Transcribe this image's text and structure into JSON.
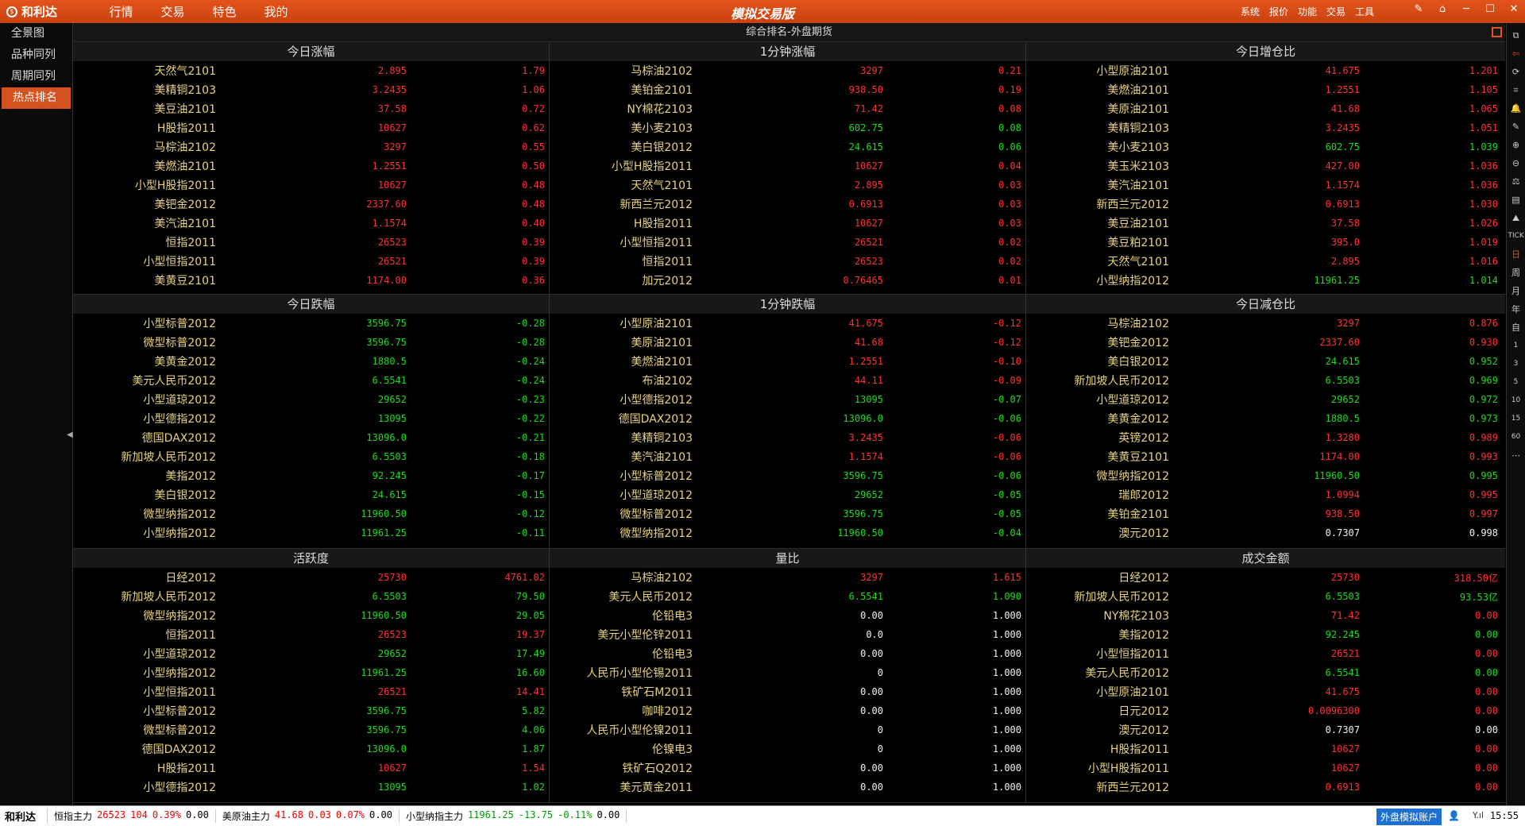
{
  "app": {
    "logo_text": "和利达",
    "logo_icon": "logo-icon",
    "title": "模拟交易版",
    "menu": [
      "行情",
      "交易",
      "特色",
      "我的"
    ],
    "right_menu": [
      "系统",
      "报价",
      "功能",
      "交易",
      "工具"
    ],
    "window_controls": [
      "✎",
      "⌂",
      "─",
      "☐",
      "✕"
    ]
  },
  "leftnav": {
    "items": [
      "全景图",
      "品种同列",
      "周期同列",
      "热点排名"
    ],
    "active_index": 3
  },
  "main": {
    "title": "综合排名-外盘期货"
  },
  "colors": {
    "up": "#ff3232",
    "down": "#1edc1e",
    "flat": "#f0f0f0",
    "name": "#e8d27a",
    "accent": "#e4541c"
  },
  "panels": [
    {
      "title": "今日涨幅",
      "rows": [
        [
          "天然气2101",
          "2.895",
          "r",
          "1.79",
          "r"
        ],
        [
          "美精铜2103",
          "3.2435",
          "r",
          "1.06",
          "r"
        ],
        [
          "美豆油2101",
          "37.58",
          "r",
          "0.72",
          "r"
        ],
        [
          "H股指2011",
          "10627",
          "r",
          "0.62",
          "r"
        ],
        [
          "马棕油2102",
          "3297",
          "r",
          "0.55",
          "r"
        ],
        [
          "美燃油2101",
          "1.2551",
          "r",
          "0.50",
          "r"
        ],
        [
          "小型H股指2011",
          "10627",
          "r",
          "0.48",
          "r"
        ],
        [
          "美钯金2012",
          "2337.60",
          "r",
          "0.48",
          "r"
        ],
        [
          "美汽油2101",
          "1.1574",
          "r",
          "0.40",
          "r"
        ],
        [
          "恒指2011",
          "26523",
          "r",
          "0.39",
          "r"
        ],
        [
          "小型恒指2011",
          "26521",
          "r",
          "0.39",
          "r"
        ],
        [
          "美黄豆2101",
          "1174.00",
          "r",
          "0.36",
          "r"
        ]
      ]
    },
    {
      "title": "1分钟涨幅",
      "rows": [
        [
          "马棕油2102",
          "3297",
          "r",
          "0.21",
          "r"
        ],
        [
          "美铂金2101",
          "938.50",
          "r",
          "0.19",
          "r"
        ],
        [
          "NY棉花2103",
          "71.42",
          "r",
          "0.08",
          "r"
        ],
        [
          "美小麦2103",
          "602.75",
          "g",
          "0.08",
          "g"
        ],
        [
          "美白银2012",
          "24.615",
          "g",
          "0.06",
          "g"
        ],
        [
          "小型H股指2011",
          "10627",
          "r",
          "0.04",
          "r"
        ],
        [
          "天然气2101",
          "2.895",
          "r",
          "0.03",
          "r"
        ],
        [
          "新西兰元2012",
          "0.6913",
          "r",
          "0.03",
          "r"
        ],
        [
          "H股指2011",
          "10627",
          "r",
          "0.03",
          "r"
        ],
        [
          "小型恒指2011",
          "26521",
          "r",
          "0.02",
          "r"
        ],
        [
          "恒指2011",
          "26523",
          "r",
          "0.02",
          "r"
        ],
        [
          "加元2012",
          "0.76465",
          "r",
          "0.01",
          "r"
        ]
      ]
    },
    {
      "title": "今日增仓比",
      "rows": [
        [
          "小型原油2101",
          "41.675",
          "r",
          "1.201",
          "r"
        ],
        [
          "美燃油2101",
          "1.2551",
          "r",
          "1.105",
          "r"
        ],
        [
          "美原油2101",
          "41.68",
          "r",
          "1.065",
          "r"
        ],
        [
          "美精铜2103",
          "3.2435",
          "r",
          "1.051",
          "r"
        ],
        [
          "美小麦2103",
          "602.75",
          "g",
          "1.039",
          "g"
        ],
        [
          "美玉米2103",
          "427.00",
          "r",
          "1.036",
          "r"
        ],
        [
          "美汽油2101",
          "1.1574",
          "r",
          "1.036",
          "r"
        ],
        [
          "新西兰元2012",
          "0.6913",
          "r",
          "1.030",
          "r"
        ],
        [
          "美豆油2101",
          "37.58",
          "r",
          "1.026",
          "r"
        ],
        [
          "美豆粕2101",
          "395.0",
          "r",
          "1.019",
          "r"
        ],
        [
          "天然气2101",
          "2.895",
          "r",
          "1.016",
          "r"
        ],
        [
          "小型纳指2012",
          "11961.25",
          "g",
          "1.014",
          "g"
        ]
      ]
    },
    {
      "title": "今日跌幅",
      "rows": [
        [
          "小型标普2012",
          "3596.75",
          "g",
          "-0.28",
          "g"
        ],
        [
          "微型标普2012",
          "3596.75",
          "g",
          "-0.28",
          "g"
        ],
        [
          "美黄金2012",
          "1880.5",
          "g",
          "-0.24",
          "g"
        ],
        [
          "美元人民币2012",
          "6.5541",
          "g",
          "-0.24",
          "g"
        ],
        [
          "小型道琼2012",
          "29652",
          "g",
          "-0.23",
          "g"
        ],
        [
          "小型德指2012",
          "13095",
          "g",
          "-0.22",
          "g"
        ],
        [
          "德国DAX2012",
          "13096.0",
          "g",
          "-0.21",
          "g"
        ],
        [
          "新加坡人民币2012",
          "6.5503",
          "g",
          "-0.18",
          "g"
        ],
        [
          "美指2012",
          "92.245",
          "g",
          "-0.17",
          "g"
        ],
        [
          "美白银2012",
          "24.615",
          "g",
          "-0.15",
          "g"
        ],
        [
          "微型纳指2012",
          "11960.50",
          "g",
          "-0.12",
          "g"
        ],
        [
          "小型纳指2012",
          "11961.25",
          "g",
          "-0.11",
          "g"
        ]
      ]
    },
    {
      "title": "1分钟跌幅",
      "rows": [
        [
          "小型原油2101",
          "41.675",
          "r",
          "-0.12",
          "r"
        ],
        [
          "美原油2101",
          "41.68",
          "r",
          "-0.12",
          "r"
        ],
        [
          "美燃油2101",
          "1.2551",
          "r",
          "-0.10",
          "r"
        ],
        [
          "布油2102",
          "44.11",
          "r",
          "-0.09",
          "r"
        ],
        [
          "小型德指2012",
          "13095",
          "g",
          "-0.07",
          "g"
        ],
        [
          "德国DAX2012",
          "13096.0",
          "g",
          "-0.06",
          "g"
        ],
        [
          "美精铜2103",
          "3.2435",
          "r",
          "-0.06",
          "r"
        ],
        [
          "美汽油2101",
          "1.1574",
          "r",
          "-0.06",
          "r"
        ],
        [
          "小型标普2012",
          "3596.75",
          "g",
          "-0.06",
          "g"
        ],
        [
          "小型道琼2012",
          "29652",
          "g",
          "-0.05",
          "g"
        ],
        [
          "微型标普2012",
          "3596.75",
          "g",
          "-0.05",
          "g"
        ],
        [
          "微型纳指2012",
          "11960.50",
          "g",
          "-0.04",
          "g"
        ]
      ]
    },
    {
      "title": "今日减仓比",
      "rows": [
        [
          "马棕油2102",
          "3297",
          "r",
          "0.876",
          "r"
        ],
        [
          "美钯金2012",
          "2337.60",
          "r",
          "0.930",
          "r"
        ],
        [
          "美白银2012",
          "24.615",
          "g",
          "0.952",
          "g"
        ],
        [
          "新加坡人民币2012",
          "6.5503",
          "g",
          "0.969",
          "g"
        ],
        [
          "小型道琼2012",
          "29652",
          "g",
          "0.972",
          "g"
        ],
        [
          "美黄金2012",
          "1880.5",
          "g",
          "0.973",
          "g"
        ],
        [
          "英镑2012",
          "1.3280",
          "r",
          "0.989",
          "r"
        ],
        [
          "美黄豆2101",
          "1174.00",
          "r",
          "0.993",
          "r"
        ],
        [
          "微型纳指2012",
          "11960.50",
          "g",
          "0.995",
          "g"
        ],
        [
          "瑞郎2012",
          "1.0994",
          "r",
          "0.995",
          "r"
        ],
        [
          "美铂金2101",
          "938.50",
          "r",
          "0.997",
          "r"
        ],
        [
          "澳元2012",
          "0.7307",
          "w",
          "0.998",
          "w"
        ]
      ]
    },
    {
      "title": "活跃度",
      "rows": [
        [
          "日经2012",
          "25730",
          "r",
          "4761.02",
          "r"
        ],
        [
          "新加坡人民币2012",
          "6.5503",
          "g",
          "79.50",
          "g"
        ],
        [
          "微型纳指2012",
          "11960.50",
          "g",
          "29.05",
          "g"
        ],
        [
          "恒指2011",
          "26523",
          "r",
          "19.37",
          "r"
        ],
        [
          "小型道琼2012",
          "29652",
          "g",
          "17.49",
          "g"
        ],
        [
          "小型纳指2012",
          "11961.25",
          "g",
          "16.60",
          "g"
        ],
        [
          "小型恒指2011",
          "26521",
          "r",
          "14.41",
          "r"
        ],
        [
          "小型标普2012",
          "3596.75",
          "g",
          "5.82",
          "g"
        ],
        [
          "微型标普2012",
          "3596.75",
          "g",
          "4.06",
          "g"
        ],
        [
          "德国DAX2012",
          "13096.0",
          "g",
          "1.87",
          "g"
        ],
        [
          "H股指2011",
          "10627",
          "r",
          "1.54",
          "r"
        ],
        [
          "小型德指2012",
          "13095",
          "g",
          "1.02",
          "g"
        ]
      ]
    },
    {
      "title": "量比",
      "rows": [
        [
          "马棕油2102",
          "3297",
          "r",
          "1.615",
          "r"
        ],
        [
          "美元人民币2012",
          "6.5541",
          "g",
          "1.090",
          "g"
        ],
        [
          "伦铅电3",
          "0.00",
          "w",
          "1.000",
          "w"
        ],
        [
          "美元小型伦锌2011",
          "0.0",
          "w",
          "1.000",
          "w"
        ],
        [
          "伦铅电3",
          "0.00",
          "w",
          "1.000",
          "w"
        ],
        [
          "人民币小型伦锡2011",
          "0",
          "w",
          "1.000",
          "w"
        ],
        [
          "铁矿石M2011",
          "0.00",
          "w",
          "1.000",
          "w"
        ],
        [
          "咖啡2012",
          "0.00",
          "w",
          "1.000",
          "w"
        ],
        [
          "人民币小型伦镍2011",
          "0",
          "w",
          "1.000",
          "w"
        ],
        [
          "伦镍电3",
          "0",
          "w",
          "1.000",
          "w"
        ],
        [
          "铁矿石Q2012",
          "0.00",
          "w",
          "1.000",
          "w"
        ],
        [
          "美元黄金2011",
          "0.00",
          "w",
          "1.000",
          "w"
        ]
      ]
    },
    {
      "title": "成交金额",
      "rows": [
        [
          "日经2012",
          "25730",
          "r",
          "318.50亿",
          "r"
        ],
        [
          "新加坡人民币2012",
          "6.5503",
          "g",
          "93.53亿",
          "g"
        ],
        [
          "NY棉花2103",
          "71.42",
          "r",
          "0.00",
          "r"
        ],
        [
          "美指2012",
          "92.245",
          "g",
          "0.00",
          "g"
        ],
        [
          "小型恒指2011",
          "26521",
          "r",
          "0.00",
          "r"
        ],
        [
          "美元人民币2012",
          "6.5541",
          "g",
          "0.00",
          "g"
        ],
        [
          "小型原油2101",
          "41.675",
          "r",
          "0.00",
          "r"
        ],
        [
          "日元2012",
          "0.0096300",
          "r",
          "0.00",
          "r"
        ],
        [
          "澳元2012",
          "0.7307",
          "w",
          "0.00",
          "w"
        ],
        [
          "H股指2011",
          "10627",
          "r",
          "0.00",
          "r"
        ],
        [
          "小型H股指2011",
          "10627",
          "r",
          "0.00",
          "r"
        ],
        [
          "新西兰元2012",
          "0.6913",
          "r",
          "0.00",
          "r"
        ]
      ]
    }
  ],
  "righttools": [
    {
      "glyph": "⧉",
      "icon": "window-icon",
      "hl": false
    },
    {
      "glyph": "⇦",
      "icon": "back-icon",
      "hl": true
    },
    {
      "glyph": "⟳",
      "icon": "refresh-icon",
      "hl": false
    },
    {
      "glyph": "⌗",
      "icon": "crop-icon",
      "hl": false
    },
    {
      "glyph": "🔔",
      "icon": "bell-icon",
      "hl": false
    },
    {
      "glyph": "✎",
      "icon": "pen-icon",
      "hl": false
    },
    {
      "glyph": "⊕",
      "icon": "zoom-in-icon",
      "hl": false
    },
    {
      "glyph": "⊖",
      "icon": "zoom-out-icon",
      "hl": false
    },
    {
      "glyph": "⚖",
      "icon": "balance-icon",
      "hl": false
    },
    {
      "glyph": "▤",
      "icon": "list-icon",
      "hl": false
    },
    {
      "glyph": "⛰",
      "icon": "chart-icon",
      "hl": false
    },
    {
      "glyph": "TICK",
      "icon": "tick-label",
      "hl": false,
      "sm": true
    },
    {
      "glyph": "日",
      "icon": "day-label",
      "hl": true
    },
    {
      "glyph": "周",
      "icon": "week-label",
      "hl": false
    },
    {
      "glyph": "月",
      "icon": "month-label",
      "hl": false
    },
    {
      "glyph": "年",
      "icon": "year-label",
      "hl": false
    },
    {
      "glyph": "自",
      "icon": "custom-label",
      "hl": false
    },
    {
      "glyph": "1",
      "icon": "period-1",
      "hl": false,
      "sm": true
    },
    {
      "glyph": "3",
      "icon": "period-3",
      "hl": false,
      "sm": true
    },
    {
      "glyph": "5",
      "icon": "period-5",
      "hl": false,
      "sm": true
    },
    {
      "glyph": "10",
      "icon": "period-10",
      "hl": false,
      "sm": true
    },
    {
      "glyph": "15",
      "icon": "period-15",
      "hl": false,
      "sm": true
    },
    {
      "glyph": "60",
      "icon": "period-60",
      "hl": false,
      "sm": true
    },
    {
      "glyph": "⋯",
      "icon": "more-icon",
      "hl": false
    }
  ],
  "statusbar": {
    "logo": "和利达",
    "tickers": [
      {
        "name": "恒指主力",
        "price": "26523",
        "change": "104",
        "pct": "0.39%",
        "extra": "0.00",
        "dir": "r"
      },
      {
        "name": "美原油主力",
        "price": "41.68",
        "change": "0.03",
        "pct": "0.07%",
        "extra": "0.00",
        "dir": "r"
      },
      {
        "name": "小型纳指主力",
        "price": "11961.25",
        "change": "-13.75",
        "pct": "-0.11%",
        "extra": "0.00",
        "dir": "g"
      }
    ],
    "account": "外盘模拟账户",
    "user_icon": "👤",
    "signal_icon": "Y.ıl",
    "time": "15:55"
  }
}
